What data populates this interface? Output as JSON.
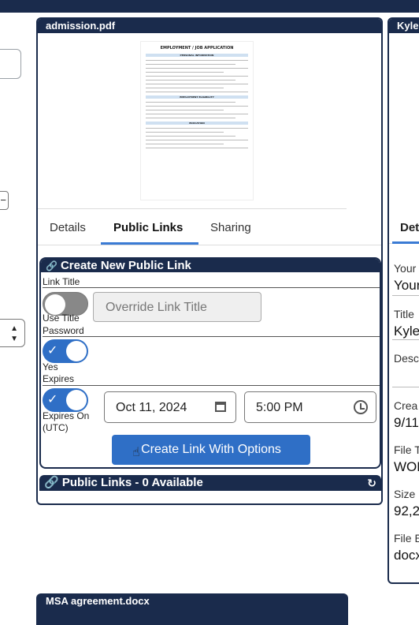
{
  "main_card": {
    "filename": "admission.pdf",
    "preview": {
      "doc_title": "EMPLOYMENT / JOB APPLICATION",
      "sections": [
        "PERSONAL INFORMATION",
        "EMPLOYMENT ELIGIBILITY",
        "EDUCATION"
      ]
    },
    "tabs": [
      "Details",
      "Public Links",
      "Sharing"
    ],
    "active_tab": "Public Links"
  },
  "create_link": {
    "header": "Create New Public Link",
    "link_title_label": "Link Title",
    "use_title_label": "Use Title",
    "title_placeholder": "Override Link Title",
    "password_label": "Password",
    "password_toggle_label": "Yes",
    "expires_label": "Expires",
    "expires_on_label": "Expires On",
    "utc_label": "(UTC)",
    "expiry_date": "Oct 11, 2024",
    "expiry_time": "5:00 PM",
    "button_label": "Create Link With Options"
  },
  "public_links": {
    "header": "Public Links - 0 Available"
  },
  "right_card": {
    "title": "Kyle",
    "tab": "Det",
    "labels": [
      "Your",
      "Title",
      "Desc",
      "Crea",
      "File T",
      "Size",
      "File E"
    ],
    "values": [
      "Your",
      "Kyle",
      "",
      "9/11,",
      "WOR",
      "92,2",
      "docx"
    ]
  },
  "bottom_card": {
    "filename": "MSA agreement.docx"
  },
  "colors": {
    "navy": "#1a2b4c",
    "accent": "#2f6fc6",
    "tab_underline": "#3b7bd4"
  },
  "icons": [
    "link-icon",
    "calendar-icon",
    "clock-icon",
    "refresh-icon",
    "hand-cursor-icon"
  ]
}
